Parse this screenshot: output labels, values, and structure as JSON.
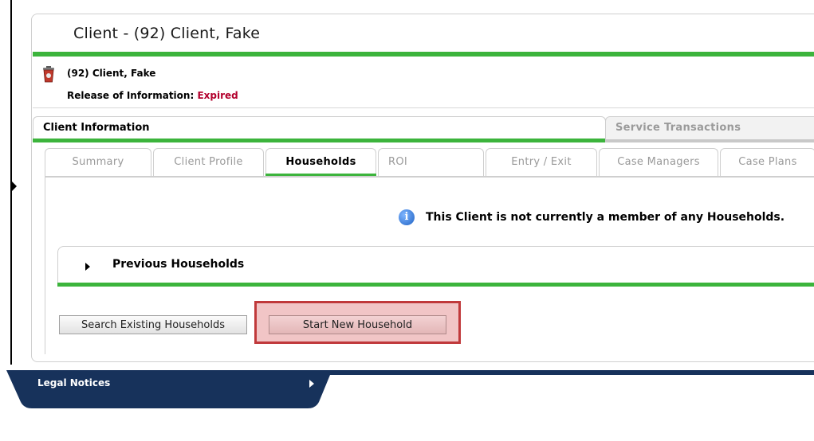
{
  "header": {
    "title": "Client - (92) Client, Fake"
  },
  "client": {
    "name": "(92) Client, Fake",
    "roi_label": "Release of Information:",
    "roi_status": "Expired"
  },
  "main_tabs": [
    {
      "label": "Client Information",
      "active": true
    },
    {
      "label": "Service Transactions",
      "active": false
    }
  ],
  "sub_tabs": [
    {
      "label": "Summary",
      "active": false
    },
    {
      "label": "Client Profile",
      "active": false
    },
    {
      "label": "Households",
      "active": true
    },
    {
      "label": "ROI",
      "active": false
    },
    {
      "label": "Entry / Exit",
      "active": false
    },
    {
      "label": "Case Managers",
      "active": false
    },
    {
      "label": "Case Plans",
      "active": false
    }
  ],
  "households": {
    "info_message": "This Client is not currently a member of any Households.",
    "previous_label": "Previous Households",
    "search_button": "Search Existing Households",
    "start_button": "Start New Household"
  },
  "footer": {
    "legal_label": "Legal Notices"
  },
  "colors": {
    "accent_green": "#3cb43c",
    "footer_navy": "#17325b",
    "expired_red": "#b3002d",
    "highlight_red": "#c0393b"
  },
  "icons": [
    "client-trash-icon",
    "info-icon",
    "expand-arrow-icon"
  ]
}
